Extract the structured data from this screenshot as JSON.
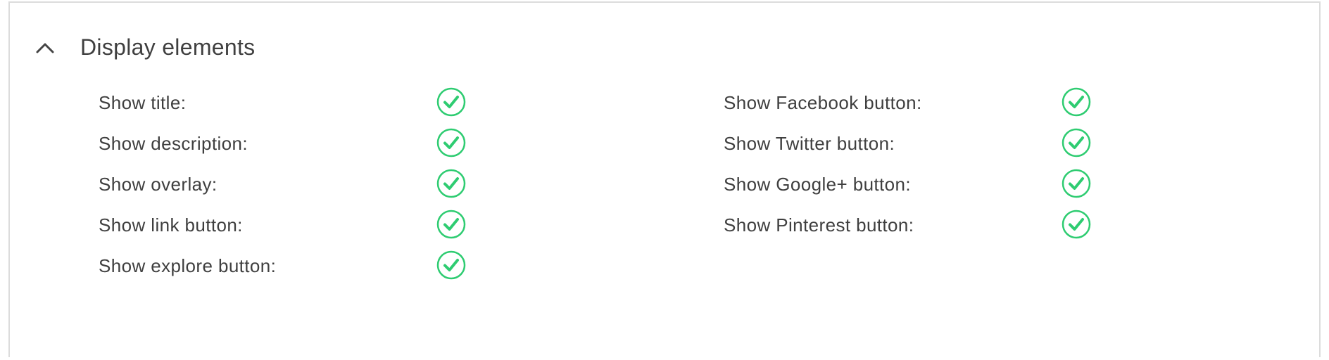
{
  "panel": {
    "title": "Display elements",
    "toggle_icon": "chevron-up-icon",
    "check_color": "#2ecc71"
  },
  "left_options": [
    {
      "label": "Show title:",
      "checked": true
    },
    {
      "label": "Show description:",
      "checked": true
    },
    {
      "label": "Show overlay:",
      "checked": true
    },
    {
      "label": "Show link button:",
      "checked": true
    },
    {
      "label": "Show explore button:",
      "checked": true
    }
  ],
  "right_options": [
    {
      "label": "Show Facebook button:",
      "checked": true
    },
    {
      "label": "Show Twitter button:",
      "checked": true
    },
    {
      "label": "Show Google+ button:",
      "checked": true
    },
    {
      "label": "Show Pinterest button:",
      "checked": true
    }
  ]
}
